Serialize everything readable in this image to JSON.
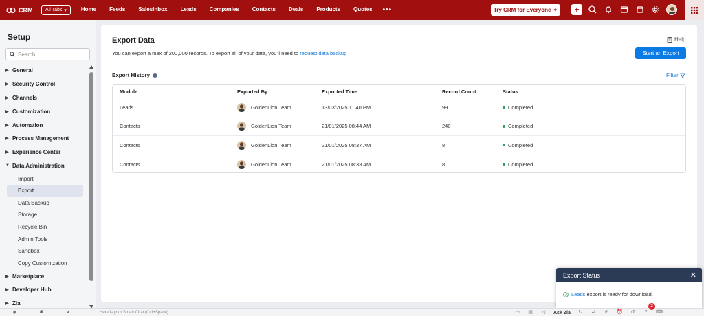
{
  "topbar": {
    "brand": "CRM",
    "all_tabs": "All Tabs",
    "nav": [
      "Home",
      "Feeds",
      "SalesInbox",
      "Leads",
      "Companies",
      "Contacts",
      "Deals",
      "Products",
      "Quotes"
    ],
    "more": "•••",
    "try_button": "Try CRM for Everyone",
    "icons": [
      "plus-icon",
      "search-icon",
      "bell-icon",
      "calendar-icon",
      "store-icon",
      "gear-icon"
    ],
    "accent": "#a10f0f"
  },
  "sidebar": {
    "title": "Setup",
    "search_placeholder": "Search",
    "categories_top": [
      "General",
      "Security Control",
      "Channels",
      "Customization",
      "Automation",
      "Process Management",
      "Experience Center"
    ],
    "expanded": "Data Administration",
    "sub_items": [
      "Import",
      "Export",
      "Data Backup",
      "Storage",
      "Recycle Bin",
      "Admin Tools",
      "Sandbox",
      "Copy Customization"
    ],
    "active_sub": "Export",
    "categories_bottom": [
      "Marketplace",
      "Developer Hub",
      "Zia"
    ]
  },
  "main": {
    "title": "Export Data",
    "desc_prefix": "You can export a max of 200,000 records. To export all of your data, you'll need to ",
    "desc_link": "request data backup",
    "help": "Help",
    "start_button": "Start an Export",
    "history_title": "Export History",
    "filter": "Filter",
    "columns": [
      "Module",
      "Exported By",
      "Exported Time",
      "Record Count",
      "Status"
    ],
    "rows": [
      {
        "module": "Leads",
        "by": "GoldenLion Team",
        "time": "13/03/2025 11:40 PM",
        "count": "99",
        "status": "Completed"
      },
      {
        "module": "Contacts",
        "by": "GoldenLion Team",
        "time": "21/01/2025 08:44 AM",
        "count": "240",
        "status": "Completed"
      },
      {
        "module": "Contacts",
        "by": "GoldenLion Team",
        "time": "21/01/2025 08:37 AM",
        "count": "8",
        "status": "Completed"
      },
      {
        "module": "Contacts",
        "by": "GoldenLion Team",
        "time": "21/01/2025 08:33 AM",
        "count": "8",
        "status": "Completed"
      }
    ],
    "button_color": "#0a7ae6",
    "status_color": "#2a9d5c"
  },
  "toast": {
    "title": "Export Status",
    "link": "Leads",
    "message": " export is ready for download."
  },
  "bottombar": {
    "smart_chat": "Here is your Smart Chat (Ctrl+Space)",
    "ask_zia": "Ask Zia",
    "badge": "2"
  }
}
